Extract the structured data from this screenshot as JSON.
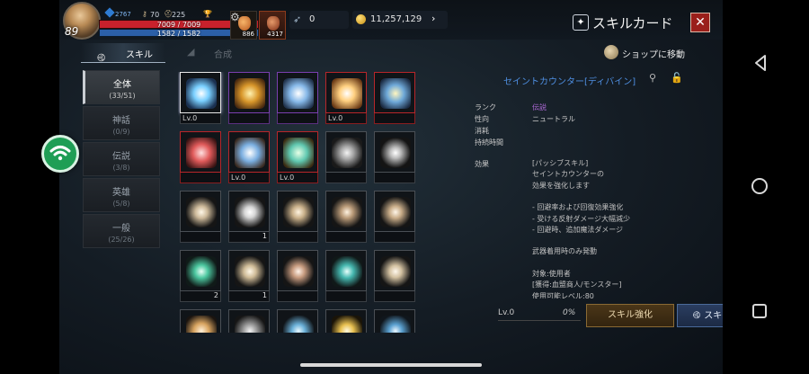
{
  "hud": {
    "level": "89",
    "power": "2767",
    "stat_a": "70",
    "stat_b": "225",
    "hp": "7009 / 7009",
    "mp": "1582 / 1582",
    "potion1_count": "886",
    "potion2_count": "4317",
    "feather_count": "0",
    "gold": "11,257,129"
  },
  "panel": {
    "title": "スキルカード",
    "tab_skill": "スキル",
    "tab_compose": "合成",
    "shop": "ショップに移動"
  },
  "categories": [
    {
      "name": "全体",
      "count": "(33/51)"
    },
    {
      "name": "神話",
      "count": "(0/9)"
    },
    {
      "name": "伝説",
      "count": "(3/8)"
    },
    {
      "name": "英雄",
      "count": "(5/8)"
    },
    {
      "name": "一般",
      "count": "(25/26)"
    }
  ],
  "grid": {
    "row1": [
      {
        "level": "Lv.0",
        "count": ""
      },
      {
        "level": "",
        "count": ""
      },
      {
        "level": "",
        "count": ""
      },
      {
        "level": "Lv.0",
        "count": ""
      },
      {
        "level": "",
        "count": ""
      }
    ],
    "row2": [
      {
        "level": "",
        "count": ""
      },
      {
        "level": "Lv.0",
        "count": ""
      },
      {
        "level": "Lv.0",
        "count": ""
      },
      {
        "level": "",
        "count": ""
      },
      {
        "level": "",
        "count": ""
      }
    ],
    "row3": [
      {
        "level": "",
        "count": ""
      },
      {
        "level": "",
        "count": "1"
      },
      {
        "level": "",
        "count": ""
      },
      {
        "level": "",
        "count": ""
      },
      {
        "level": "",
        "count": ""
      }
    ],
    "row4": [
      {
        "level": "",
        "count": "2"
      },
      {
        "level": "",
        "count": "1"
      },
      {
        "level": "",
        "count": ""
      },
      {
        "level": "",
        "count": ""
      },
      {
        "level": "",
        "count": ""
      }
    ]
  },
  "detail": {
    "title": "セイントカウンター[ディバイン]",
    "rank_label": "ランク",
    "rank_value": "伝説",
    "nature_label": "性向",
    "nature_value": "ニュートラル",
    "cost_label": "消耗",
    "duration_label": "持続時間",
    "effect_label": "効果",
    "effect_lines": [
      "[パッシブスキル]",
      "セイントカウンターの",
      "効果を強化します",
      "",
      "- 回避率および回復効果強化",
      "- 受ける反射ダメージ大幅減少",
      "- 回避時、追加魔法ダメージ",
      "",
      "武器着用時のみ発動",
      "",
      "対象:使用者",
      "[獲得:血盟商人/モンスター]",
      "使用可能レベル:80"
    ],
    "progress_level": "Lv.0",
    "progress_pct": "0%",
    "progress_value": 0,
    "enhance_btn": "スキル強化",
    "move_btn": "スキル移動"
  }
}
